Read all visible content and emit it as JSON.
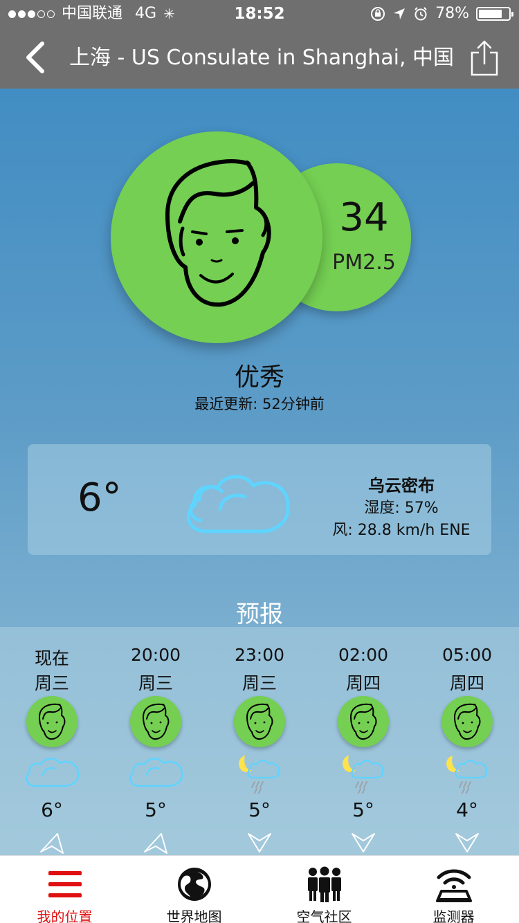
{
  "status_bar": {
    "carrier": "中国联通",
    "network": "4G",
    "time": "18:52",
    "battery_percent": "78%",
    "battery_level": 0.78
  },
  "nav": {
    "title": "上海 - US Consulate in Shanghai, 中国",
    "back_icon": "chevron-left-icon",
    "share_icon": "share-icon"
  },
  "aqi": {
    "value": "34",
    "unit": "PM2.5",
    "quality": "优秀",
    "updated": "最近更新: 52分钟前",
    "color": "#74cf52"
  },
  "weather": {
    "temperature": "6°",
    "condition": "乌云密布",
    "humidity": "湿度: 57%",
    "wind": "风: 28.8 km/h ENE",
    "icon": "cloud-icon",
    "icon_color": "#5ed4ff"
  },
  "forecast": {
    "title": "预报",
    "items": [
      {
        "time": "现在",
        "day": "周三",
        "temp": "6°",
        "weather_icon": "cloud-icon"
      },
      {
        "time": "20:00",
        "day": "周三",
        "temp": "5°",
        "weather_icon": "cloud-icon"
      },
      {
        "time": "23:00",
        "day": "周三",
        "temp": "5°",
        "weather_icon": "moon-rain-icon"
      },
      {
        "time": "02:00",
        "day": "周四",
        "temp": "5°",
        "weather_icon": "moon-rain-icon"
      },
      {
        "time": "05:00",
        "day": "周四",
        "temp": "4°",
        "weather_icon": "moon-rain-icon"
      }
    ]
  },
  "tabs": [
    {
      "label": "我的位置",
      "icon": "menu-icon",
      "active": true
    },
    {
      "label": "世界地图",
      "icon": "globe-icon",
      "active": false
    },
    {
      "label": "空气社区",
      "icon": "community-icon",
      "active": false
    },
    {
      "label": "监测器",
      "icon": "monitor-icon",
      "active": false
    }
  ],
  "colors": {
    "nav_bg": "#6f6f6f",
    "active_tab": "#e01010"
  }
}
